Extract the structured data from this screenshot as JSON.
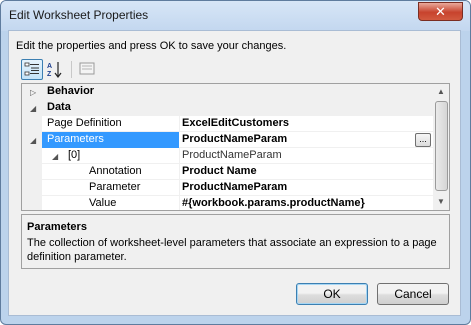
{
  "window": {
    "title": "Edit Worksheet Properties",
    "close_glyph": "✕"
  },
  "instruction": "Edit the properties and press OK to save your changes.",
  "toolbar": {
    "categorized_icon": "categorized-icon",
    "alphabetical_icon": "alphabetical-icon",
    "property_pages_icon": "property-pages-icon",
    "alpha_label": "AZ"
  },
  "grid": {
    "categories": [
      {
        "label": "Behavior",
        "expander": "▷"
      },
      {
        "label": "Data",
        "expander": "◢"
      }
    ],
    "rows": [
      {
        "label": "Page Definition",
        "value": "ExcelEditCustomers"
      },
      {
        "label": "Parameters",
        "value": "ProductNameParam",
        "expander": "◢",
        "button": "..."
      },
      {
        "label": "[0]",
        "value": "ProductNameParam",
        "expander": "◢"
      },
      {
        "label": "Annotation",
        "value": "Product Name"
      },
      {
        "label": "Parameter",
        "value": "ProductNameParam"
      },
      {
        "label": "Value",
        "value": "#{workbook.params.productName}"
      }
    ],
    "scroll_up": "▲",
    "scroll_down": "▼"
  },
  "help": {
    "title": "Parameters",
    "description": "The collection of worksheet-level parameters that associate an expression to a page definition parameter."
  },
  "buttons": {
    "ok": "OK",
    "cancel": "Cancel"
  }
}
